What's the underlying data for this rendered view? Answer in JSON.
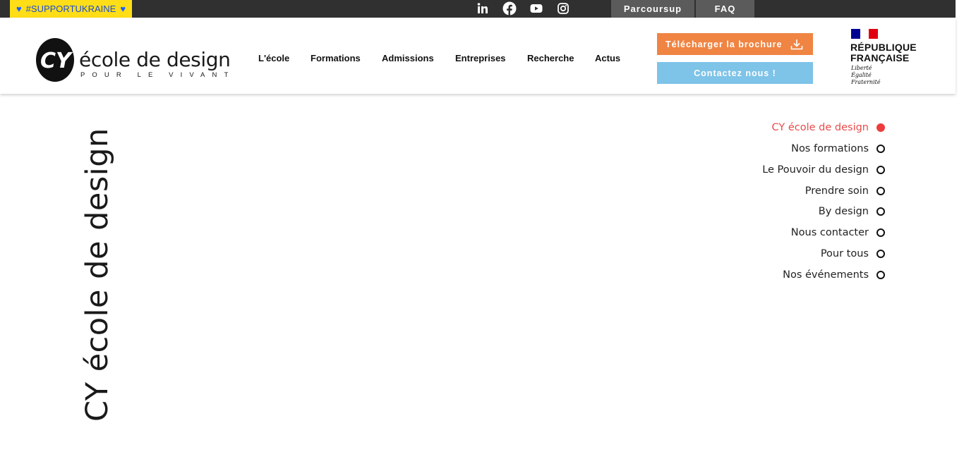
{
  "colors": {
    "topbar": "#303030",
    "ukraine_bg": "#ffde17",
    "ukraine_text": "#1e4bd6",
    "topbtn_bg": "#5b5b5b",
    "cta_orange": "#f08442",
    "cta_blue": "#7ec3e8",
    "anchor_active": "#ee3c3c",
    "flag_blue": "#000091",
    "flag_red": "#e1000f"
  },
  "topbar": {
    "ukraine_tag": "#SUPPORTUKRAINE",
    "ukraine_icon": "blue-heart-icon",
    "social_icons": [
      "linkedin-icon",
      "facebook-icon",
      "youtube-icon",
      "instagram-icon"
    ],
    "parcoursup_label": "Parcoursup",
    "faq_label": "FAQ"
  },
  "logo": {
    "name": "école de design",
    "sub": "POUR LE VIVANT",
    "mark_letters": "CY"
  },
  "nav": {
    "items": [
      {
        "label": "L'école"
      },
      {
        "label": "Formations"
      },
      {
        "label": "Admissions"
      },
      {
        "label": "Entreprises"
      },
      {
        "label": "Recherche"
      },
      {
        "label": "Actus"
      }
    ]
  },
  "cta": {
    "brochure_label": "Télécharger la brochure",
    "brochure_icon": "download-icon",
    "contact_label": "Contactez nous !"
  },
  "republique": {
    "line1": "RÉPUBLIQUE",
    "line2": "FRANÇAISE",
    "motto": [
      "Liberté",
      "Égalité",
      "Fraternité"
    ]
  },
  "main": {
    "vertical_title": "CY école de design",
    "anchors": [
      {
        "label": "CY école de design",
        "active": true
      },
      {
        "label": "Nos formations",
        "active": false
      },
      {
        "label": "Le Pouvoir du design",
        "active": false
      },
      {
        "label": "Prendre soin",
        "active": false
      },
      {
        "label": "By design",
        "active": false
      },
      {
        "label": "Nous contacter",
        "active": false
      },
      {
        "label": "Pour tous",
        "active": false
      },
      {
        "label": "Nos événements",
        "active": false
      }
    ]
  }
}
